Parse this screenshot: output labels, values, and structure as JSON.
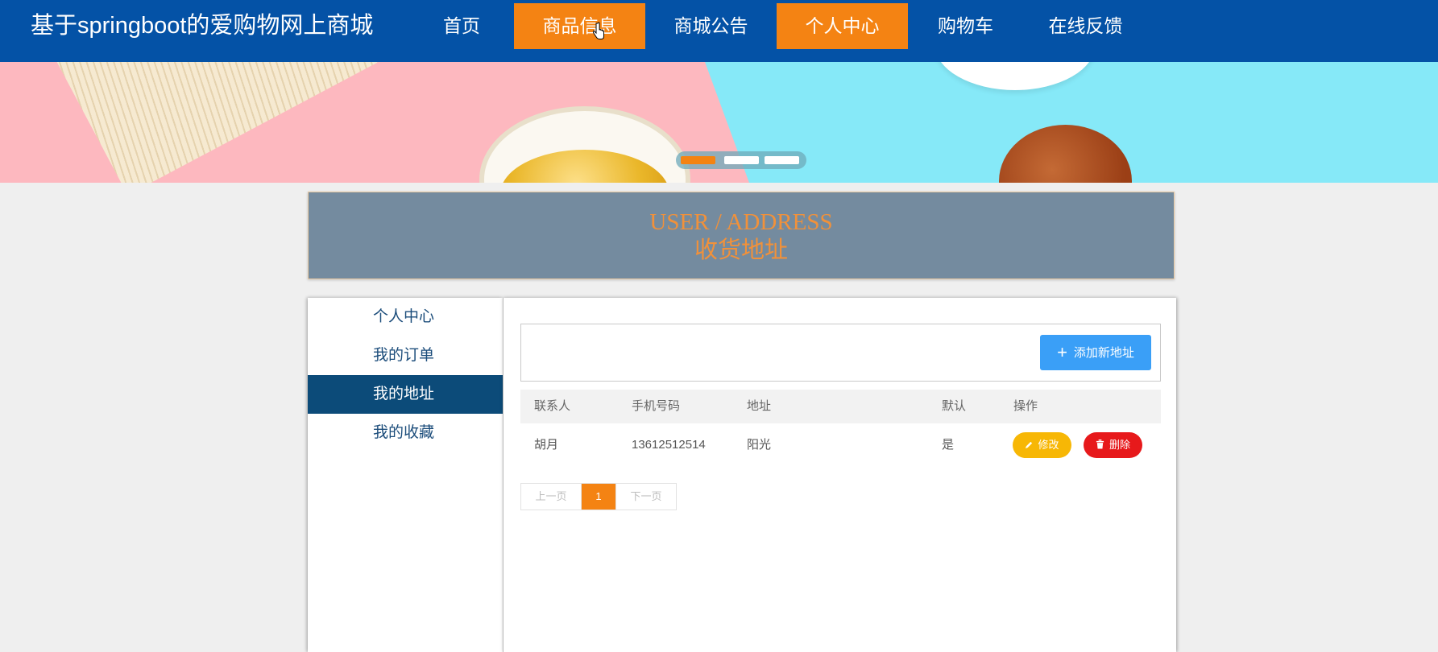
{
  "site": {
    "title": "基于springboot的爱购物网上商城"
  },
  "nav": [
    {
      "label": "首页",
      "active": false
    },
    {
      "label": "商品信息",
      "active": true
    },
    {
      "label": "商城公告",
      "active": false
    },
    {
      "label": "个人中心",
      "active": true
    },
    {
      "label": "购物车",
      "active": false
    },
    {
      "label": "在线反馈",
      "active": false
    }
  ],
  "banner": {
    "slide_count": 3,
    "active_slide": 1
  },
  "header": {
    "en": "USER / ADDRESS",
    "cn": "收货地址"
  },
  "side_menu": [
    {
      "label": "个人中心"
    },
    {
      "label": "我的订单"
    },
    {
      "label": "我的地址",
      "active": true
    },
    {
      "label": "我的收藏"
    }
  ],
  "toolbar": {
    "add_label": "添加新地址"
  },
  "table": {
    "headers": [
      "联系人",
      "手机号码",
      "地址",
      "默认",
      "操作"
    ],
    "rows": [
      {
        "contact": "胡月",
        "phone": "13612512514",
        "address": "阳光",
        "default": "是"
      }
    ],
    "edit_label": "修改",
    "delete_label": "删除"
  },
  "pager": {
    "prev": "上一页",
    "current": "1",
    "next": "下一页"
  },
  "colors": {
    "nav_bg": "#0452a6",
    "accent": "#f48313",
    "add_btn": "#3a9ff7",
    "edit_btn": "#f7b705",
    "delete_btn": "#e7191b"
  }
}
